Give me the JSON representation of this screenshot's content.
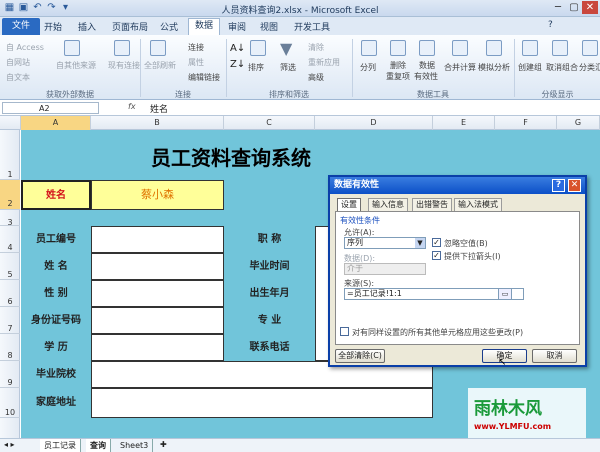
{
  "window": {
    "title": "人员资料查询2.xlsx - Microsoft Excel"
  },
  "tabs": [
    {
      "label": "文件"
    },
    {
      "label": "开始"
    },
    {
      "label": "插入"
    },
    {
      "label": "页面布局"
    },
    {
      "label": "公式"
    },
    {
      "label": "数据"
    },
    {
      "label": "审阅"
    },
    {
      "label": "视图"
    },
    {
      "label": "开发工具"
    }
  ],
  "ribbon": {
    "ext": {
      "access": "自 Access",
      "web": "自网站",
      "text": "自文本",
      "other": "自其他来源",
      "existing": "现有连接",
      "group": "获取外部数据"
    },
    "conn": {
      "refresh": "全部刷新",
      "connections": "连接",
      "properties": "属性",
      "edit_links": "编辑链接",
      "group": "连接"
    },
    "sort": {
      "sort": "排序",
      "filter": "筛选",
      "clear": "清除",
      "reapply": "重新应用",
      "advanced": "高级",
      "group": "排序和筛选"
    },
    "tools": {
      "split": "分列",
      "dedupe1": "删除",
      "dedupe2": "重复项",
      "valid1": "数据",
      "valid2": "有效性",
      "consolidate": "合并计算",
      "whatif": "模拟分析",
      "group": "数据工具"
    },
    "outline": {
      "group_btn": "创建组",
      "ungroup": "取消组合",
      "subtotal": "分类汇",
      "group": "分级显示"
    }
  },
  "formula": {
    "name_box": "A2",
    "fx": "fx",
    "value": "姓名"
  },
  "columns": [
    "A",
    "B",
    "C",
    "D",
    "E",
    "F",
    "G"
  ],
  "rows": [
    "1",
    "2",
    "3",
    "4",
    "5",
    "6",
    "7",
    "8",
    "9",
    "10"
  ],
  "sheet": {
    "title": "员工资料查询系统",
    "name_label": "姓名",
    "name_value": "蔡小森",
    "labels_left": [
      "员工编号",
      "姓 名",
      "性 别",
      "身份证号码",
      "学 历",
      "毕业院校",
      "家庭地址"
    ],
    "labels_right": [
      "职 称",
      "毕业时间",
      "出生年月",
      "专 业",
      "联系电话"
    ]
  },
  "sheet_tabs": [
    "员工记录",
    "查询",
    "Sheet3"
  ],
  "dialog": {
    "title": "数据有效性",
    "tabs": [
      "设置",
      "输入信息",
      "出错警告",
      "输入法模式"
    ],
    "section": "有效性条件",
    "allow_label": "允许(A):",
    "allow_value": "序列",
    "data_label": "数据(D):",
    "data_value": "介于",
    "ignore_blank": "忽略空值(B)",
    "dropdown": "提供下拉箭头(I)",
    "source_label": "来源(S):",
    "source_value": "=员工记录!1:1",
    "apply_all": "对有同样设置的所有其他单元格应用这些更改(P)",
    "clear_btn": "全部清除(C)",
    "ok_btn": "确定",
    "cancel_btn": "取消"
  },
  "watermark": {
    "brand": "雨林木风",
    "url": "www.YLMFU.com"
  }
}
